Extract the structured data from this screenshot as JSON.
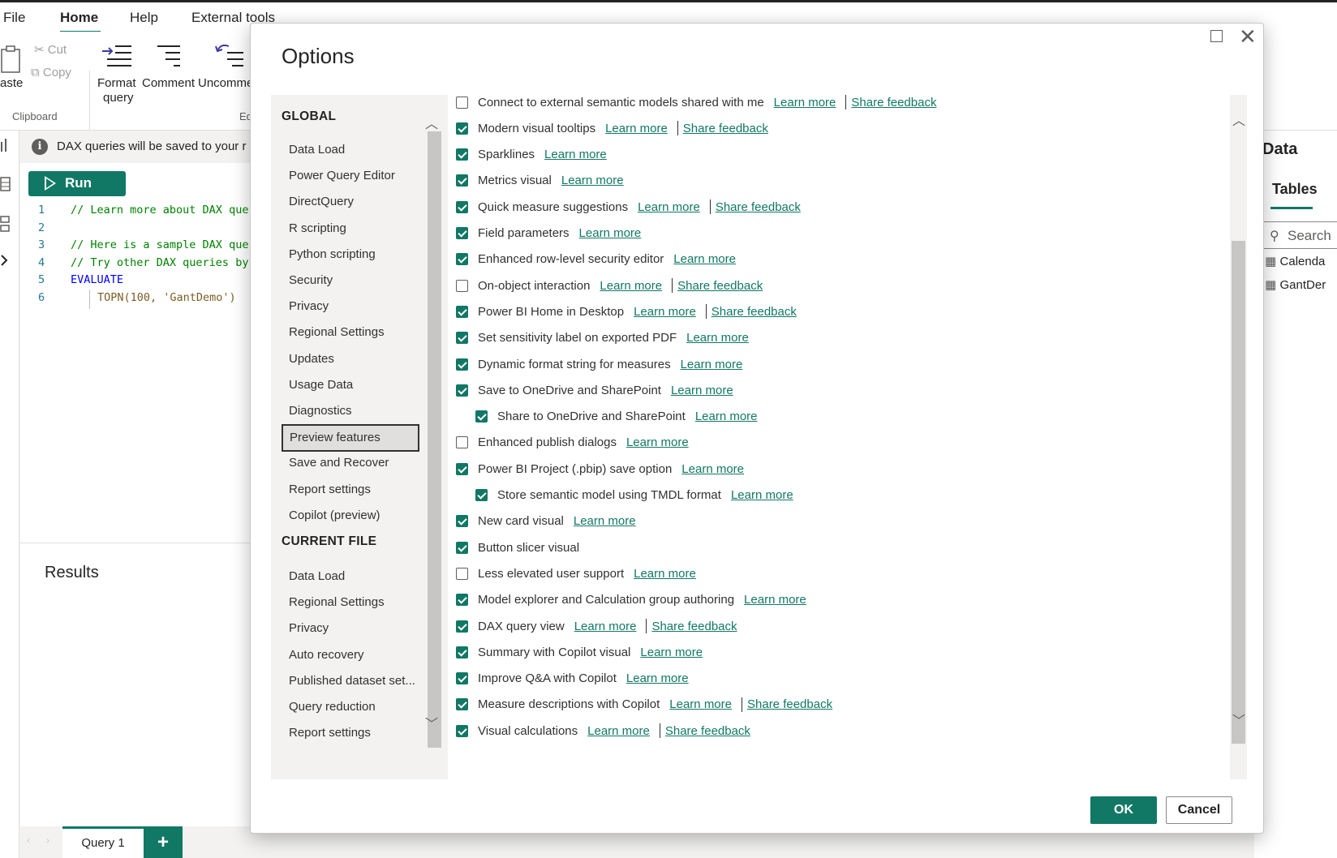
{
  "menu": {
    "file": "File",
    "home": "Home",
    "help": "Help",
    "external_tools": "External tools"
  },
  "ribbon": {
    "paste": "aste",
    "cut": "Cut",
    "copy": "Copy",
    "clipboard_group": "Clipboard",
    "format_query_1": "Format",
    "format_query_2": "query",
    "comment": "Comment",
    "uncomment": "Uncomme",
    "edit_group": "Ed"
  },
  "infobar": {
    "text": "DAX queries will be saved to your r"
  },
  "editor": {
    "run_label": "Run",
    "lines": [
      {
        "num": "1",
        "text": "// Learn more about DAX que"
      },
      {
        "num": "2",
        "text": ""
      },
      {
        "num": "3",
        "text": "// Here is a sample DAX que"
      },
      {
        "num": "4",
        "text": "// Try other DAX queries by"
      },
      {
        "num": "5",
        "text": "EVALUATE"
      },
      {
        "num": "6",
        "text": "TOPN(100, 'GantDemo')"
      }
    ]
  },
  "results": {
    "title": "Results"
  },
  "bottom_tabs": {
    "query": "Query 1",
    "add": "+"
  },
  "right_pane": {
    "title": "Data",
    "tab": "Tables",
    "search_placeholder": "Search",
    "items": [
      "Calenda",
      "GantDer"
    ]
  },
  "dialog": {
    "title": "Options",
    "ok": "OK",
    "cancel": "Cancel",
    "global_header": "GLOBAL",
    "global_items": [
      "Data Load",
      "Power Query Editor",
      "DirectQuery",
      "R scripting",
      "Python scripting",
      "Security",
      "Privacy",
      "Regional Settings",
      "Updates",
      "Usage Data",
      "Diagnostics",
      "Preview features",
      "Save and Recover",
      "Report settings",
      "Copilot (preview)"
    ],
    "selected_item": "Preview features",
    "current_header": "CURRENT FILE",
    "current_items": [
      "Data Load",
      "Regional Settings",
      "Privacy",
      "Auto recovery",
      "Published dataset set...",
      "Query reduction",
      "Report settings"
    ],
    "learn_more": "Learn more",
    "share_feedback": "Share feedback",
    "options": [
      {
        "label": "Connect to external semantic models shared with me",
        "checked": false,
        "indent": false,
        "learn": true,
        "feedback": true
      },
      {
        "label": "Modern visual tooltips",
        "checked": true,
        "indent": false,
        "learn": true,
        "feedback": true
      },
      {
        "label": "Sparklines",
        "checked": true,
        "indent": false,
        "learn": true,
        "feedback": false
      },
      {
        "label": "Metrics visual",
        "checked": true,
        "indent": false,
        "learn": true,
        "feedback": false
      },
      {
        "label": "Quick measure suggestions",
        "checked": true,
        "indent": false,
        "learn": true,
        "feedback": true
      },
      {
        "label": "Field parameters",
        "checked": true,
        "indent": false,
        "learn": true,
        "feedback": false
      },
      {
        "label": "Enhanced row-level security editor",
        "checked": true,
        "indent": false,
        "learn": true,
        "feedback": false
      },
      {
        "label": "On-object interaction",
        "checked": false,
        "indent": false,
        "learn": true,
        "feedback": true
      },
      {
        "label": "Power BI Home in Desktop",
        "checked": true,
        "indent": false,
        "learn": true,
        "feedback": true
      },
      {
        "label": "Set sensitivity label on exported PDF",
        "checked": true,
        "indent": false,
        "learn": true,
        "feedback": false
      },
      {
        "label": "Dynamic format string for measures",
        "checked": true,
        "indent": false,
        "learn": true,
        "feedback": false
      },
      {
        "label": "Save to OneDrive and SharePoint",
        "checked": true,
        "indent": false,
        "learn": true,
        "feedback": false
      },
      {
        "label": "Share to OneDrive and SharePoint",
        "checked": true,
        "indent": true,
        "learn": true,
        "feedback": false
      },
      {
        "label": "Enhanced publish dialogs",
        "checked": false,
        "indent": false,
        "learn": true,
        "feedback": false
      },
      {
        "label": "Power BI Project (.pbip) save option",
        "checked": true,
        "indent": false,
        "learn": true,
        "feedback": false
      },
      {
        "label": "Store semantic model using TMDL format",
        "checked": true,
        "indent": true,
        "learn": true,
        "feedback": false
      },
      {
        "label": "New card visual",
        "checked": true,
        "indent": false,
        "learn": true,
        "feedback": false
      },
      {
        "label": "Button slicer visual",
        "checked": true,
        "indent": false,
        "learn": false,
        "feedback": false
      },
      {
        "label": "Less elevated user support",
        "checked": false,
        "indent": false,
        "learn": true,
        "feedback": false
      },
      {
        "label": "Model explorer and Calculation group authoring",
        "checked": true,
        "indent": false,
        "learn": true,
        "feedback": false
      },
      {
        "label": "DAX query view",
        "checked": true,
        "indent": false,
        "learn": true,
        "feedback": true
      },
      {
        "label": "Summary with Copilot visual",
        "checked": true,
        "indent": false,
        "learn": true,
        "feedback": false
      },
      {
        "label": "Improve Q&A with Copilot",
        "checked": true,
        "indent": false,
        "learn": true,
        "feedback": false
      },
      {
        "label": "Measure descriptions with Copilot",
        "checked": true,
        "indent": false,
        "learn": true,
        "feedback": true
      },
      {
        "label": "Visual calculations",
        "checked": true,
        "indent": false,
        "learn": true,
        "feedback": true
      }
    ]
  }
}
